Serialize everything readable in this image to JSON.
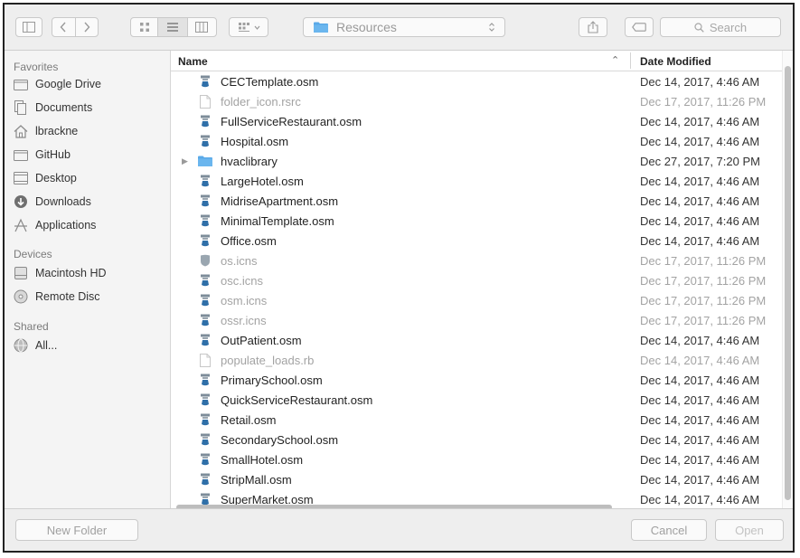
{
  "toolbar": {
    "location": "Resources",
    "search_placeholder": "Search"
  },
  "sidebar": {
    "favorites_heading": "Favorites",
    "favorites": [
      {
        "label": "Google Drive",
        "icon": "folder-icon"
      },
      {
        "label": "Documents",
        "icon": "documents-icon"
      },
      {
        "label": "lbrackne",
        "icon": "home-icon"
      },
      {
        "label": "GitHub",
        "icon": "folder-icon"
      },
      {
        "label": "Desktop",
        "icon": "desktop-icon"
      },
      {
        "label": "Downloads",
        "icon": "downloads-icon"
      },
      {
        "label": "Applications",
        "icon": "applications-icon"
      }
    ],
    "devices_heading": "Devices",
    "devices": [
      {
        "label": "Macintosh HD",
        "icon": "hard-drive-icon"
      },
      {
        "label": "Remote Disc",
        "icon": "disc-icon"
      }
    ],
    "shared_heading": "Shared",
    "shared": [
      {
        "label": "All...",
        "icon": "network-icon"
      }
    ]
  },
  "list": {
    "col_name": "Name",
    "col_date": "Date Modified",
    "rows": [
      {
        "name": "CECTemplate.osm",
        "date": "Dec 14, 2017, 4:46 AM",
        "kind": "osm",
        "dim": false
      },
      {
        "name": "folder_icon.rsrc",
        "date": "Dec 17, 2017, 11:26 PM",
        "kind": "doc",
        "dim": true
      },
      {
        "name": "FullServiceRestaurant.osm",
        "date": "Dec 14, 2017, 4:46 AM",
        "kind": "osm",
        "dim": false
      },
      {
        "name": "Hospital.osm",
        "date": "Dec 14, 2017, 4:46 AM",
        "kind": "osm",
        "dim": false
      },
      {
        "name": "hvaclibrary",
        "date": "Dec 27, 2017, 7:20 PM",
        "kind": "folder",
        "dim": false
      },
      {
        "name": "LargeHotel.osm",
        "date": "Dec 14, 2017, 4:46 AM",
        "kind": "osm",
        "dim": false
      },
      {
        "name": "MidriseApartment.osm",
        "date": "Dec 14, 2017, 4:46 AM",
        "kind": "osm",
        "dim": false
      },
      {
        "name": "MinimalTemplate.osm",
        "date": "Dec 14, 2017, 4:46 AM",
        "kind": "osm",
        "dim": false
      },
      {
        "name": "Office.osm",
        "date": "Dec 14, 2017, 4:46 AM",
        "kind": "osm",
        "dim": false
      },
      {
        "name": "os.icns",
        "date": "Dec 17, 2017, 11:26 PM",
        "kind": "icns",
        "dim": true
      },
      {
        "name": "osc.icns",
        "date": "Dec 17, 2017, 11:26 PM",
        "kind": "osm",
        "dim": true
      },
      {
        "name": "osm.icns",
        "date": "Dec 17, 2017, 11:26 PM",
        "kind": "osm",
        "dim": true
      },
      {
        "name": "ossr.icns",
        "date": "Dec 17, 2017, 11:26 PM",
        "kind": "osm",
        "dim": true
      },
      {
        "name": "OutPatient.osm",
        "date": "Dec 14, 2017, 4:46 AM",
        "kind": "osm",
        "dim": false
      },
      {
        "name": "populate_loads.rb",
        "date": "Dec 14, 2017, 4:46 AM",
        "kind": "doc",
        "dim": true
      },
      {
        "name": "PrimarySchool.osm",
        "date": "Dec 14, 2017, 4:46 AM",
        "kind": "osm",
        "dim": false
      },
      {
        "name": "QuickServiceRestaurant.osm",
        "date": "Dec 14, 2017, 4:46 AM",
        "kind": "osm",
        "dim": false
      },
      {
        "name": "Retail.osm",
        "date": "Dec 14, 2017, 4:46 AM",
        "kind": "osm",
        "dim": false
      },
      {
        "name": "SecondarySchool.osm",
        "date": "Dec 14, 2017, 4:46 AM",
        "kind": "osm",
        "dim": false
      },
      {
        "name": "SmallHotel.osm",
        "date": "Dec 14, 2017, 4:46 AM",
        "kind": "osm",
        "dim": false
      },
      {
        "name": "StripMall.osm",
        "date": "Dec 14, 2017, 4:46 AM",
        "kind": "osm",
        "dim": false
      },
      {
        "name": "SuperMarket.osm",
        "date": "Dec 14, 2017, 4:46 AM",
        "kind": "osm",
        "dim": false
      }
    ]
  },
  "footer": {
    "new_folder": "New Folder",
    "cancel": "Cancel",
    "open": "Open"
  }
}
